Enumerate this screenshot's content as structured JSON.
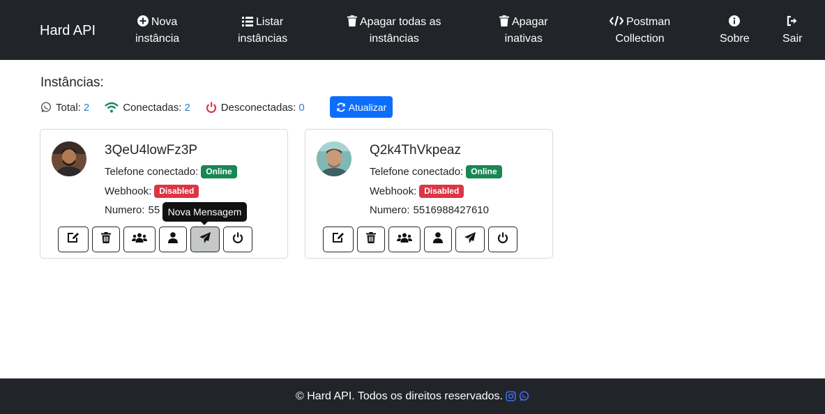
{
  "nav": {
    "brand": "Hard API",
    "items": [
      {
        "l1": "Nova",
        "l2": "instância",
        "icon": "plus-circle-icon"
      },
      {
        "l1": "Listar",
        "l2": "instâncias",
        "icon": "list-icon"
      },
      {
        "l1": "Apagar todas as",
        "l2": "instâncias",
        "icon": "trash-icon"
      },
      {
        "l1": "Apagar",
        "l2": "inativas",
        "icon": "trash-icon"
      },
      {
        "l1": "Postman",
        "l2": "Collection",
        "icon": "code-icon"
      },
      {
        "l1": "",
        "l2": "Sobre",
        "icon": "info-icon"
      },
      {
        "l1": "",
        "l2": "Sair",
        "icon": "sign-out-icon"
      }
    ]
  },
  "main": {
    "title": "Instâncias:",
    "stats": {
      "total_label": "Total:",
      "total_value": "2",
      "connected_label": "Conectadas:",
      "connected_value": "2",
      "disconnected_label": "Desconectadas:",
      "disconnected_value": "0"
    },
    "refresh_label": "Atualizar"
  },
  "cards": [
    {
      "name": "3QeU4lowFz3P",
      "phone_label": "Telefone conectado:",
      "phone_status": "Online",
      "webhook_label": "Webhook:",
      "webhook_status": "Disabled",
      "number_label": "Numero:",
      "number_value": "55"
    },
    {
      "name": "Q2k4ThVkpeaz",
      "phone_label": "Telefone conectado:",
      "phone_status": "Online",
      "webhook_label": "Webhook:",
      "webhook_status": "Disabled",
      "number_label": "Numero:",
      "number_value": "5516988427610"
    }
  ],
  "tooltip": "Nova Mensagem",
  "footer": {
    "text": "© Hard API. Todos os direitos reservados."
  },
  "colors": {
    "navbar": "#212529",
    "primary": "#0d6efd",
    "success": "#198754",
    "danger": "#dc3545",
    "link": "#2f7cc1"
  }
}
